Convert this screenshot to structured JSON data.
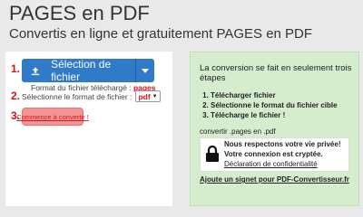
{
  "header": {
    "title": "PAGES en PDF",
    "subtitle": "Convertis en ligne et gratuitement PAGES en PDF"
  },
  "steps": {
    "step1_num": "1.",
    "step2_num": "2.",
    "step3_num": "3.",
    "upload_label": "Sélection de fichier",
    "file_type_label": "Format du fichier téléchargé :",
    "file_type_value": "pages",
    "format_label": "Sélectionne le format de fichier :",
    "format_value": "pdf",
    "convert_label": "Commence à convertir !"
  },
  "info": {
    "title": "La conversion se fait en seulement trois étapes",
    "items": [
      "Télécharger fichier",
      "Sélectionne le format du fichier cible",
      "Télécharge le fichier !"
    ],
    "convert_note": "convertir .pages en .pdf",
    "privacy_line1": "Nous respectons votre vie privée!",
    "privacy_line2": "Votre connexion est cryptée.",
    "privacy_link": "Déclaration de confidentialité",
    "bookmark_link": "Ajoute un signet pour PDF-Convertisseur.fr"
  },
  "colors": {
    "accent_blue": "#2f7ac9",
    "accent_red": "#d9141b",
    "info_bg": "#d6edcd"
  },
  "icons": [
    "upload-icon",
    "caret-down-icon",
    "lock-icon"
  ]
}
